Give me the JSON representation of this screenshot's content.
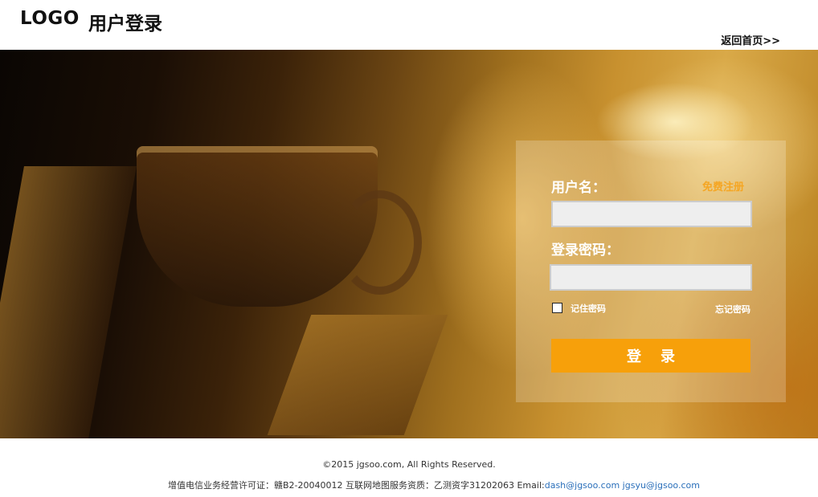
{
  "header": {
    "logo": "LOGO",
    "title": "用户登录",
    "back_home": "返回首页>>"
  },
  "login": {
    "username_label": "用户名：",
    "register_link": "免费注册",
    "username_value": "",
    "password_label": "登录密码：",
    "password_value": "",
    "remember_label": "记住密码",
    "remember_checked": false,
    "forgot_link": "忘记密码",
    "submit_label": "登录"
  },
  "footer": {
    "copyright": "©2015 jgsoo.com, All Rights Reserved.",
    "license_text": "增值电信业务经营许可证：赣B2-20040012 互联网地图服务资质：乙测资字31202063 Email:",
    "email_1": "dash@jgsoo.com",
    "email_2": "jgsyu@jgsoo.com"
  },
  "colors": {
    "accent": "#f7a00a",
    "register_link": "#f5a623",
    "email_link": "#2a6fba"
  }
}
